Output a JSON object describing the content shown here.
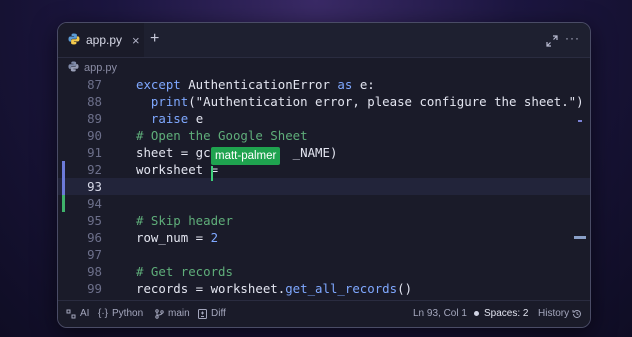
{
  "tab": {
    "filename": "app.py",
    "close": "×",
    "new_tab": "+"
  },
  "menu": "···",
  "breadcrumb": "app.py",
  "lines": [
    {
      "num": "87",
      "parts": [
        {
          "t": "except ",
          "c": "kw"
        },
        {
          "t": "AuthenticationError ",
          "c": ""
        },
        {
          "t": "as ",
          "c": "kw"
        },
        {
          "t": "e:",
          "c": ""
        }
      ]
    },
    {
      "num": "88",
      "parts": [
        {
          "t": "  print",
          "c": "fn"
        },
        {
          "t": "(\"Authentication error, please configure the sheet.\")",
          "c": ""
        }
      ]
    },
    {
      "num": "89",
      "parts": [
        {
          "t": "  raise ",
          "c": "kw"
        },
        {
          "t": "e",
          "c": ""
        }
      ]
    },
    {
      "num": "90",
      "parts": [
        {
          "t": "# Open the Google Sheet",
          "c": "cm"
        }
      ]
    },
    {
      "num": "91",
      "parts": [
        {
          "t": "sheet = gc.",
          "c": ""
        },
        {
          "t": "          ",
          "c": ""
        },
        {
          "t": "_NAME)",
          "c": ""
        }
      ]
    },
    {
      "num": "92",
      "parts": [
        {
          "t": "worksheet = ",
          "c": ""
        }
      ]
    },
    {
      "num": "93",
      "parts": []
    },
    {
      "num": "94",
      "parts": []
    },
    {
      "num": "95",
      "parts": [
        {
          "t": "# Skip header",
          "c": "cm"
        }
      ]
    },
    {
      "num": "96",
      "parts": [
        {
          "t": "row_num = ",
          "c": ""
        },
        {
          "t": "2",
          "c": "kw"
        }
      ]
    },
    {
      "num": "97",
      "parts": []
    },
    {
      "num": "98",
      "parts": [
        {
          "t": "# Get records",
          "c": "cm"
        }
      ]
    },
    {
      "num": "99",
      "parts": [
        {
          "t": "records = worksheet.",
          "c": ""
        },
        {
          "t": "get_all_records",
          "c": "fn"
        },
        {
          "t": "()",
          "c": ""
        }
      ]
    }
  ],
  "active_line_index": 6,
  "collaborator": {
    "name": "matt-palmer",
    "color": "#1fa34f"
  },
  "status": {
    "ai": "AI",
    "language": "Python",
    "branch": "main",
    "diff": "Diff",
    "position": "Ln 93, Col 1",
    "spaces": "Spaces: 2",
    "history": "History"
  },
  "colors": {
    "keyword": "#7fa8ff",
    "comment": "#5fae7a",
    "accent": "#3dd07a"
  }
}
